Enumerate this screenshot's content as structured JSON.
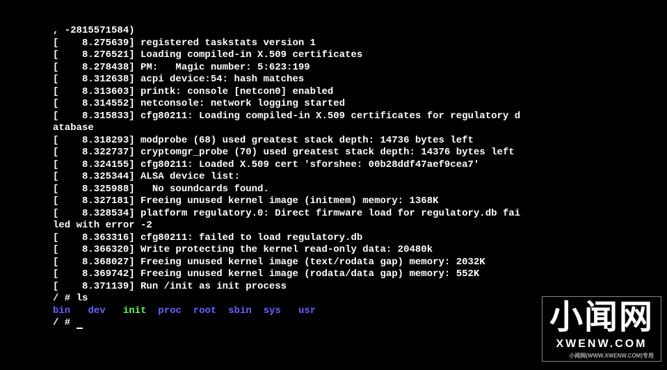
{
  "boot_lines": [
    ", -2815571584)",
    "[    8.275639] registered taskstats version 1",
    "[    8.276521] Loading compiled-in X.509 certificates",
    "[    8.278438] PM:   Magic number: 5:623:199",
    "[    8.312638] acpi device:54: hash matches",
    "[    8.313603] printk: console [netcon0] enabled",
    "[    8.314552] netconsole: network logging started",
    "[    8.315833] cfg80211: Loading compiled-in X.509 certificates for regulatory d",
    "atabase",
    "[    8.318293] modprobe (68) used greatest stack depth: 14736 bytes left",
    "[    8.322737] cryptomgr_probe (70) used greatest stack depth: 14376 bytes left",
    "[    8.324155] cfg80211: Loaded X.509 cert 'sforshee: 00b28ddf47aef9cea7'",
    "[    8.325344] ALSA device list:",
    "[    8.325988]   No soundcards found.",
    "[    8.327181] Freeing unused kernel image (initmem) memory: 1368K",
    "[    8.328534] platform regulatory.0: Direct firmware load for regulatory.db fai",
    "led with error -2",
    "[    8.363316] cfg80211: failed to load regulatory.db",
    "[    8.366320] Write protecting the kernel read-only data: 20480k",
    "[    8.368027] Freeing unused kernel image (text/rodata gap) memory: 2032K",
    "[    8.369742] Freeing unused kernel image (rodata/data gap) memory: 552K",
    "[    8.371139] Run /init as init process"
  ],
  "prompt1": {
    "prefix": "/ # ",
    "command": "ls"
  },
  "ls_output": {
    "bin": "bin",
    "dev": "dev",
    "init": "init",
    "proc": "proc",
    "root": "root",
    "sbin": "sbin",
    "sys": "sys",
    "usr": "usr"
  },
  "prompt2": {
    "prefix": "/ # "
  },
  "watermark": {
    "cn": "小闻网",
    "en": "XWENW.COM",
    "sub": "小闻网(WWW.XWENW.COM)专用"
  }
}
